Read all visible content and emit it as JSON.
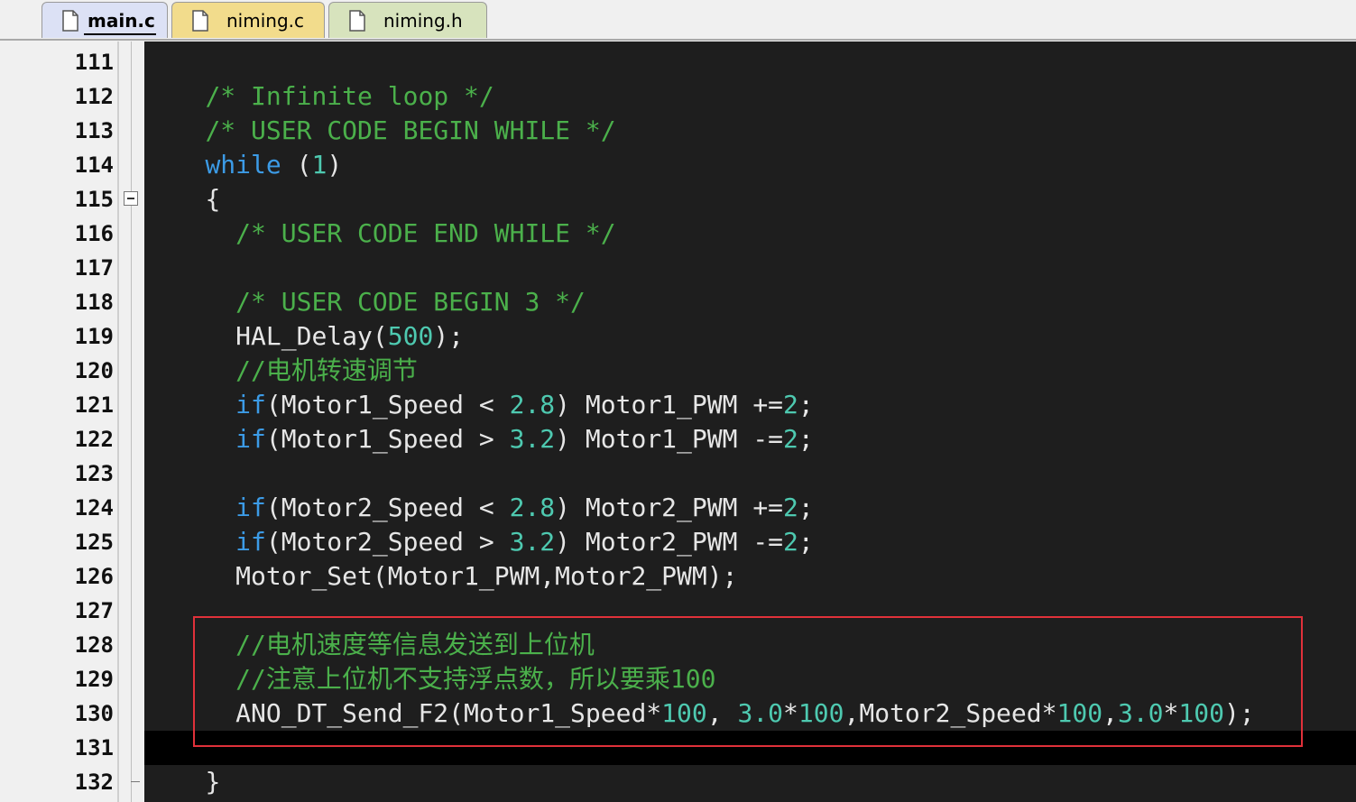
{
  "tabs": [
    {
      "label": "main.c",
      "active": true
    },
    {
      "label": "niming.c",
      "active": false
    },
    {
      "label": "niming.h",
      "active": false
    }
  ],
  "line_numbers": [
    "111",
    "112",
    "113",
    "114",
    "115",
    "116",
    "117",
    "118",
    "119",
    "120",
    "121",
    "122",
    "123",
    "124",
    "125",
    "126",
    "127",
    "128",
    "129",
    "130",
    "131",
    "132"
  ],
  "code_lines": [
    {
      "indent": "",
      "tokens": []
    },
    {
      "indent": "  ",
      "tokens": [
        {
          "t": "cm",
          "text": "/* Infinite loop */"
        }
      ]
    },
    {
      "indent": "  ",
      "tokens": [
        {
          "t": "cm",
          "text": "/* USER CODE BEGIN WHILE */"
        }
      ]
    },
    {
      "indent": "  ",
      "tokens": [
        {
          "t": "kw",
          "text": "while"
        },
        {
          "t": "tx",
          "text": " ("
        },
        {
          "t": "num",
          "text": "1"
        },
        {
          "t": "tx",
          "text": ")"
        }
      ]
    },
    {
      "indent": "  ",
      "tokens": [
        {
          "t": "tx",
          "text": "{"
        }
      ]
    },
    {
      "indent": "    ",
      "tokens": [
        {
          "t": "cm",
          "text": "/* USER CODE END WHILE */"
        }
      ]
    },
    {
      "indent": "",
      "tokens": []
    },
    {
      "indent": "    ",
      "tokens": [
        {
          "t": "cm",
          "text": "/* USER CODE BEGIN 3 */"
        }
      ]
    },
    {
      "indent": "    ",
      "tokens": [
        {
          "t": "tx",
          "text": "HAL_Delay("
        },
        {
          "t": "num",
          "text": "500"
        },
        {
          "t": "tx",
          "text": ");"
        }
      ]
    },
    {
      "indent": "    ",
      "tokens": [
        {
          "t": "cm",
          "text": "//电机转速调节"
        }
      ]
    },
    {
      "indent": "    ",
      "tokens": [
        {
          "t": "kw",
          "text": "if"
        },
        {
          "t": "tx",
          "text": "(Motor1_Speed < "
        },
        {
          "t": "num",
          "text": "2.8"
        },
        {
          "t": "tx",
          "text": ") Motor1_PWM +="
        },
        {
          "t": "num",
          "text": "2"
        },
        {
          "t": "tx",
          "text": ";"
        }
      ]
    },
    {
      "indent": "    ",
      "tokens": [
        {
          "t": "kw",
          "text": "if"
        },
        {
          "t": "tx",
          "text": "(Motor1_Speed > "
        },
        {
          "t": "num",
          "text": "3.2"
        },
        {
          "t": "tx",
          "text": ") Motor1_PWM -="
        },
        {
          "t": "num",
          "text": "2"
        },
        {
          "t": "tx",
          "text": ";"
        }
      ]
    },
    {
      "indent": "",
      "tokens": []
    },
    {
      "indent": "    ",
      "tokens": [
        {
          "t": "kw",
          "text": "if"
        },
        {
          "t": "tx",
          "text": "(Motor2_Speed < "
        },
        {
          "t": "num",
          "text": "2.8"
        },
        {
          "t": "tx",
          "text": ") Motor2_PWM +="
        },
        {
          "t": "num",
          "text": "2"
        },
        {
          "t": "tx",
          "text": ";"
        }
      ]
    },
    {
      "indent": "    ",
      "tokens": [
        {
          "t": "kw",
          "text": "if"
        },
        {
          "t": "tx",
          "text": "(Motor2_Speed > "
        },
        {
          "t": "num",
          "text": "3.2"
        },
        {
          "t": "tx",
          "text": ") Motor2_PWM -="
        },
        {
          "t": "num",
          "text": "2"
        },
        {
          "t": "tx",
          "text": ";"
        }
      ]
    },
    {
      "indent": "    ",
      "tokens": [
        {
          "t": "tx",
          "text": "Motor_Set(Motor1_PWM,Motor2_PWM);"
        }
      ]
    },
    {
      "indent": "",
      "tokens": []
    },
    {
      "indent": "    ",
      "tokens": [
        {
          "t": "cm",
          "text": "//电机速度等信息发送到上位机"
        }
      ]
    },
    {
      "indent": "    ",
      "tokens": [
        {
          "t": "cm",
          "text": "//注意上位机不支持浮点数，所以要乘100"
        }
      ]
    },
    {
      "indent": "    ",
      "tokens": [
        {
          "t": "tx",
          "text": "ANO_DT_Send_F2(Motor1_Speed*"
        },
        {
          "t": "num",
          "text": "100"
        },
        {
          "t": "tx",
          "text": ", "
        },
        {
          "t": "num",
          "text": "3.0"
        },
        {
          "t": "tx",
          "text": "*"
        },
        {
          "t": "num",
          "text": "100"
        },
        {
          "t": "tx",
          "text": ",Motor2_Speed*"
        },
        {
          "t": "num",
          "text": "100"
        },
        {
          "t": "tx",
          "text": ","
        },
        {
          "t": "num",
          "text": "3.0"
        },
        {
          "t": "tx",
          "text": "*"
        },
        {
          "t": "num",
          "text": "100"
        },
        {
          "t": "tx",
          "text": ");"
        }
      ]
    },
    {
      "indent": "",
      "tokens": []
    },
    {
      "indent": "  ",
      "tokens": [
        {
          "t": "tx",
          "text": "}"
        }
      ]
    }
  ],
  "colors": {
    "comment": "#4bb04b",
    "keyword": "#3c9be6",
    "number": "#4ec9b0",
    "text": "#e6e6e6",
    "editor_bg": "#1e1e1e",
    "highlight_box": "#e0313a"
  }
}
